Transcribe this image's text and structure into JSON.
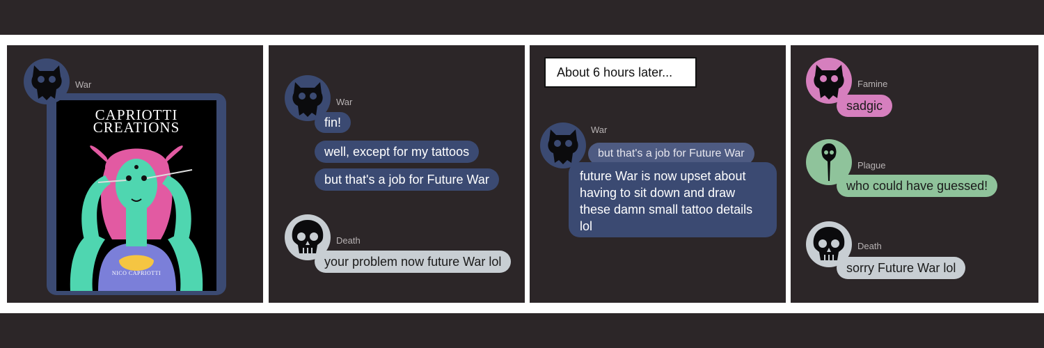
{
  "panels": [
    {
      "speaker": "War",
      "image": {
        "title_line1": "CAPRIOTTI",
        "title_line2": "CREATIONS",
        "credit": "NICO CAPRIOTTI"
      }
    },
    {
      "messages_war": {
        "speaker": "War",
        "lines": [
          "fin!",
          "well, except for my tattoos",
          "but that's a job for Future War"
        ]
      },
      "messages_death": {
        "speaker": "Death",
        "lines": [
          "your problem now future War lol"
        ]
      }
    },
    {
      "caption": "About 6 hours later...",
      "speaker": "War",
      "quoted": "but that's a job for Future War",
      "reply": [
        "future War is now upset about",
        "having to sit down and draw",
        "these damn small tattoo details",
        "lol"
      ]
    },
    {
      "famine": {
        "speaker": "Famine",
        "text": "sadgic"
      },
      "plague": {
        "speaker": "Plague",
        "text": "who could have guessed!"
      },
      "death": {
        "speaker": "Death",
        "text": "sorry Future War lol"
      }
    }
  ],
  "colors": {
    "background": "#2c2628",
    "war": "#3b4a72",
    "death": "#c8ced3",
    "famine": "#d67fbe",
    "plague": "#8fc39b"
  },
  "icons": {
    "war": "cat-skull-icon",
    "death": "human-skull-icon",
    "famine": "cat-skull-icon",
    "plague": "bird-skull-icon"
  }
}
